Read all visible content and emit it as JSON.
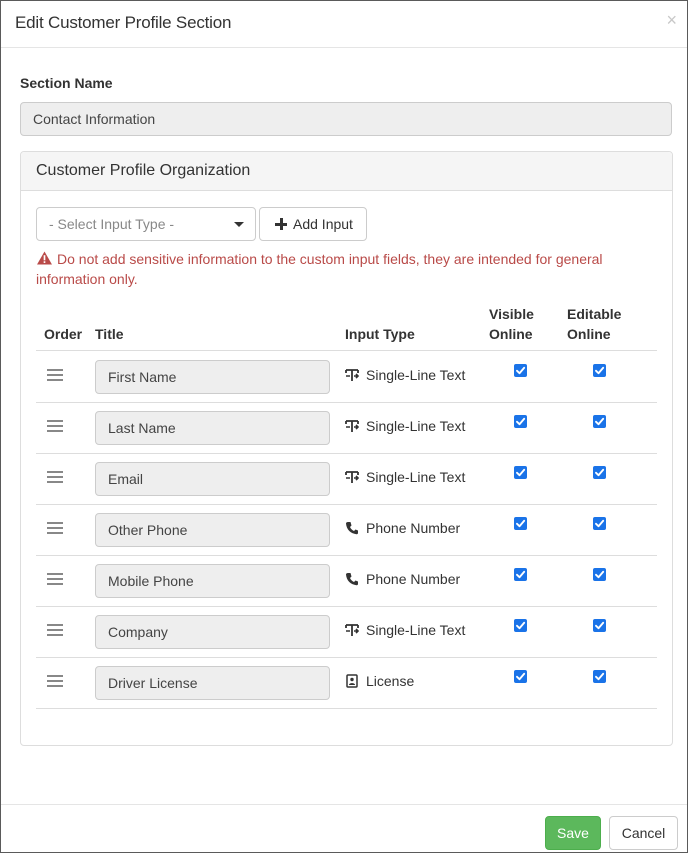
{
  "modal": {
    "title": "Edit Customer Profile Section",
    "close_symbol": "×"
  },
  "section": {
    "label": "Section Name",
    "value": "Contact Information"
  },
  "panel": {
    "title": "Customer Profile Organization",
    "select_placeholder": "- Select Input Type -",
    "add_input_label": "Add Input",
    "warning": "Do not add sensitive information to the custom input fields, they are intended for general information only."
  },
  "table": {
    "headers": {
      "order": "Order",
      "title": "Title",
      "input_type": "Input Type",
      "visible_1": "Visible",
      "visible_2": "Online",
      "editable_1": "Editable",
      "editable_2": "Online"
    },
    "rows": [
      {
        "title": "First Name",
        "type": "Single-Line Text",
        "icon": "text-input-icon",
        "visible": true,
        "editable": true
      },
      {
        "title": "Last Name",
        "type": "Single-Line Text",
        "icon": "text-input-icon",
        "visible": true,
        "editable": true
      },
      {
        "title": "Email",
        "type": "Single-Line Text",
        "icon": "text-input-icon",
        "visible": true,
        "editable": true
      },
      {
        "title": "Other Phone",
        "type": "Phone Number",
        "icon": "phone-icon",
        "visible": true,
        "editable": true
      },
      {
        "title": "Mobile Phone",
        "type": "Phone Number",
        "icon": "phone-icon",
        "visible": true,
        "editable": true
      },
      {
        "title": "Company",
        "type": "Single-Line Text",
        "icon": "text-input-icon",
        "visible": true,
        "editable": true
      },
      {
        "title": "Driver License",
        "type": "License",
        "icon": "license-icon",
        "visible": true,
        "editable": true
      }
    ]
  },
  "footer": {
    "save_label": "Save",
    "cancel_label": "Cancel"
  },
  "colors": {
    "warning": "#b94a48",
    "save": "#5cb85c",
    "checkbox": "#1a73e8"
  }
}
